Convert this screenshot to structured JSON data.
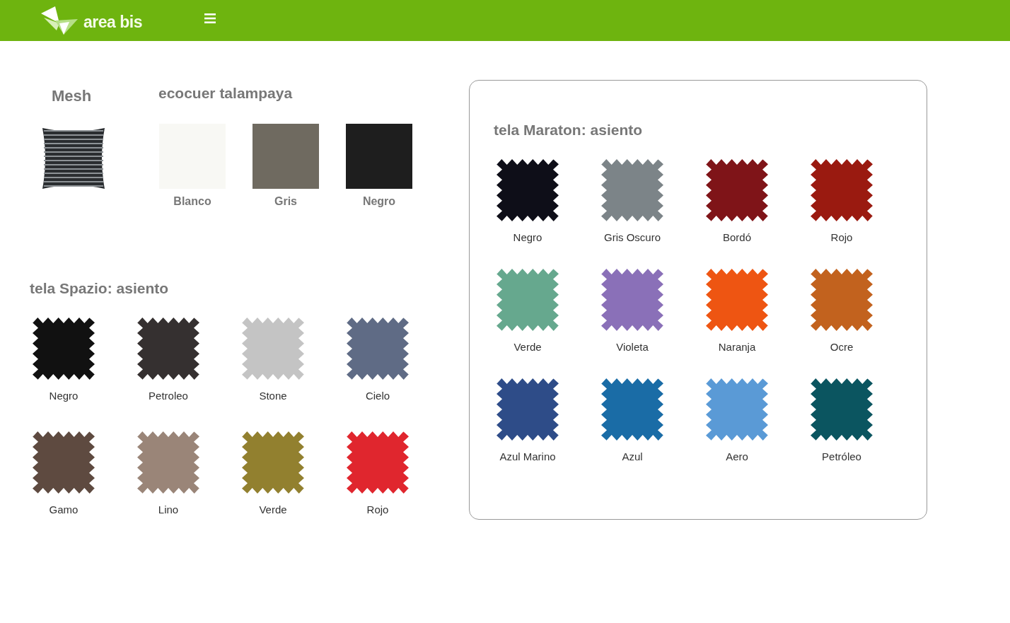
{
  "header": {
    "logo_text": "area bis"
  },
  "mesh": {
    "title": "Mesh"
  },
  "ecocuer": {
    "title": "ecocuer talampaya",
    "swatches": [
      {
        "label": "Blanco",
        "color": "#f8f8f4"
      },
      {
        "label": "Gris",
        "color": "#6f6a60"
      },
      {
        "label": "Negro",
        "color": "#1e1e1e"
      }
    ]
  },
  "spazio": {
    "title": "tela Spazio: asiento",
    "swatches": [
      {
        "label": "Negro",
        "color": "#111111"
      },
      {
        "label": "Petroleo",
        "color": "#353030"
      },
      {
        "label": "Stone",
        "color": "#c4c4c4"
      },
      {
        "label": "Cielo",
        "color": "#5f6b85"
      },
      {
        "label": "Gamo",
        "color": "#5e4a40"
      },
      {
        "label": "Lino",
        "color": "#9a8578"
      },
      {
        "label": "Verde",
        "color": "#92802f"
      },
      {
        "label": "Rojo",
        "color": "#e0262e"
      }
    ]
  },
  "maraton": {
    "title": "tela Maraton: asiento",
    "swatches": [
      {
        "label": "Negro",
        "color": "#0e0e18"
      },
      {
        "label": "Gris Oscuro",
        "color": "#7c8488"
      },
      {
        "label": "Bordó",
        "color": "#7f1418"
      },
      {
        "label": "Rojo",
        "color": "#9a1a10"
      },
      {
        "label": "Verde",
        "color": "#66a88e"
      },
      {
        "label": "Violeta",
        "color": "#8a70b8"
      },
      {
        "label": "Naranja",
        "color": "#ee5512"
      },
      {
        "label": "Ocre",
        "color": "#c2621e"
      },
      {
        "label": "Azul Marino",
        "color": "#2e4c88"
      },
      {
        "label": "Azul",
        "color": "#1a6ca6"
      },
      {
        "label": "Aero",
        "color": "#5a9ad6"
      },
      {
        "label": "Petróleo",
        "color": "#0b5560"
      }
    ]
  }
}
